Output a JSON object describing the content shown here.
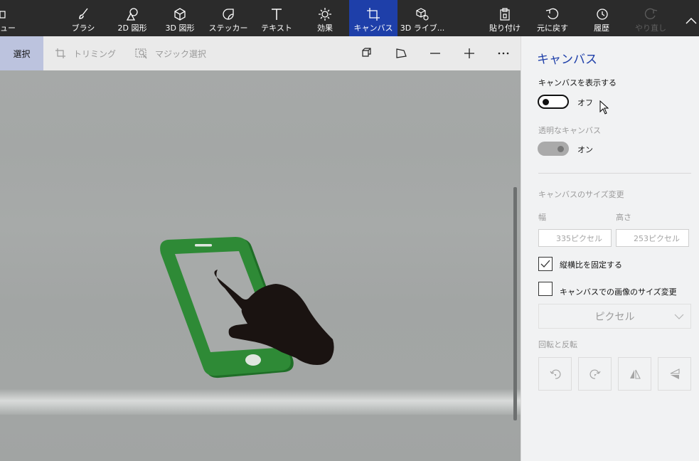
{
  "toolbar": {
    "menu_label": "ュー",
    "items": [
      {
        "label": "ブラシ",
        "icon": "brush-icon"
      },
      {
        "label": "2D 図形",
        "icon": "2d-shapes-icon"
      },
      {
        "label": "3D 図形",
        "icon": "3d-shapes-icon"
      },
      {
        "label": "ステッカー",
        "icon": "sticker-icon"
      },
      {
        "label": "テキスト",
        "icon": "text-icon"
      },
      {
        "label": "効果",
        "icon": "effects-icon"
      },
      {
        "label": "キャンバス",
        "icon": "canvas-icon",
        "active": true
      },
      {
        "label": "3D ライブ...",
        "icon": "3d-library-icon"
      }
    ],
    "right": [
      {
        "label": "貼り付け",
        "icon": "paste-icon"
      },
      {
        "label": "元に戻す",
        "icon": "undo-icon"
      },
      {
        "label": "履歴",
        "icon": "history-icon"
      },
      {
        "label": "やり直し",
        "icon": "redo-icon",
        "disabled": true
      }
    ],
    "active_color": "#1e3fa9"
  },
  "subbar": {
    "select_label": "選択",
    "crop_label": "トリミング",
    "magic_select_label": "マジック選択"
  },
  "panel": {
    "title": "キャンバス",
    "show_canvas_label": "キャンバスを表示する",
    "show_canvas_state": "オフ",
    "transparent_label": "透明なキャンバス",
    "transparent_state": "オン",
    "resize_label": "キャンバスのサイズ変更",
    "width_label": "幅",
    "height_label": "高さ",
    "width_value": "335ピクセル",
    "height_value": "253ピクセル",
    "lock_ratio_label": "縦横比を固定する",
    "lock_ratio_checked": true,
    "resize_image_label": "キャンバスでの画像のサイズ変更",
    "resize_image_checked": false,
    "unit_value": "ピクセル",
    "rotate_label": "回転と反転"
  },
  "colors": {
    "phone_green": "#2e8a36",
    "hand": "#1a1311"
  }
}
